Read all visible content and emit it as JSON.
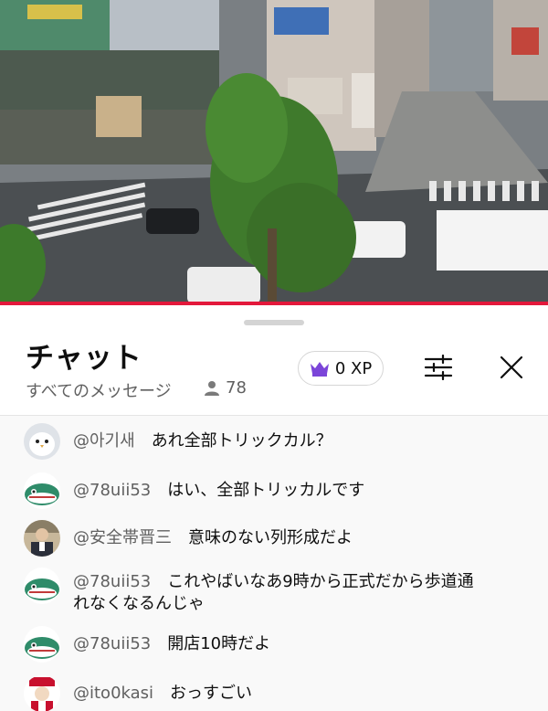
{
  "video": {
    "description_icon": "street-livestream-thumbnail"
  },
  "chat": {
    "title": "チャット",
    "filter_label": "すべてのメッセージ",
    "viewer_count": "78",
    "xp_label": "0 XP",
    "icons": {
      "viewer": "person-icon",
      "xp": "crown-icon",
      "settings": "sliders-icon",
      "close": "close-icon"
    },
    "colors": {
      "crown": "#7b45d9",
      "accent_line": "#e3183b"
    },
    "messages": [
      {
        "author": "@아기새",
        "text": "あれ全部トリックカル？",
        "avatar": "white-bird-avatar"
      },
      {
        "author": "@78uii53",
        "text": "はい、全部トリッカルです",
        "avatar": "green-shark-avatar"
      },
      {
        "author": "@安全帯晋三",
        "text": "意味のない列形成だよ",
        "avatar": "photo-avatar"
      },
      {
        "author": "@78uii53",
        "text": "これやばいなあ9時から正式だから歩道通",
        "text2": "れなくなるんじゃ",
        "avatar": "green-shark-avatar"
      },
      {
        "author": "@78uii53",
        "text": "開店10時だよ",
        "avatar": "green-shark-avatar"
      },
      {
        "author": "@ito0kasi",
        "text": "おっすごい",
        "avatar": "red-logo-avatar"
      }
    ]
  }
}
